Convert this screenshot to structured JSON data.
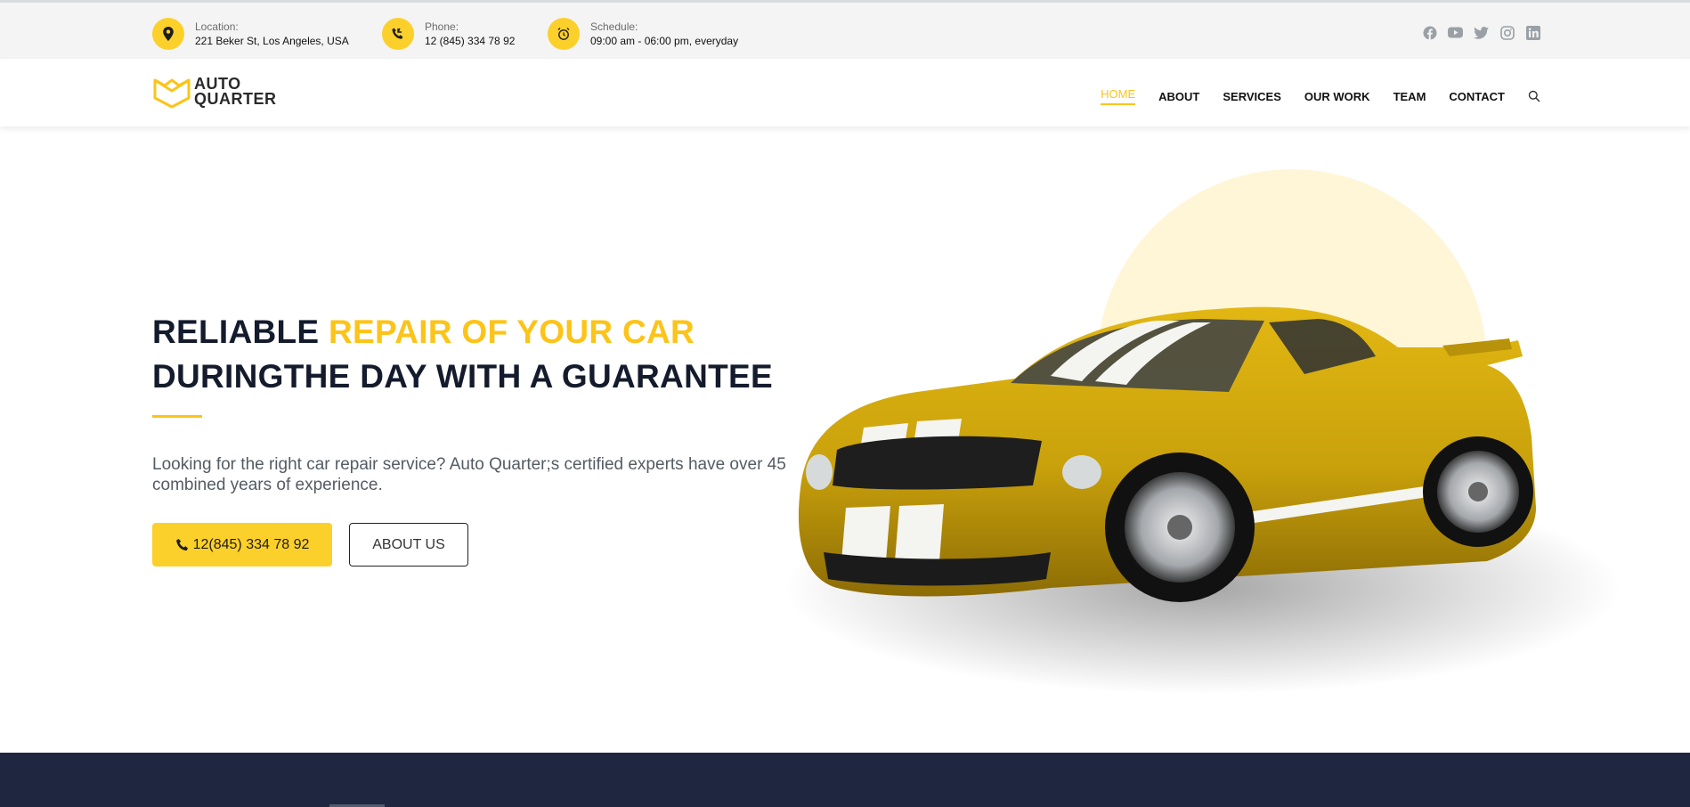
{
  "topbar": {
    "location": {
      "label": "Location:",
      "value": "221 Beker St, Los Angeles, USA"
    },
    "phone": {
      "label": "Phone:",
      "value": "12 (845) 334 78 92"
    },
    "schedule": {
      "label": "Schedule:",
      "value": "09:00 am - 06:00 pm, everyday"
    },
    "social": [
      "facebook-icon",
      "youtube-icon",
      "twitter-icon",
      "instagram-icon",
      "linkedin-icon"
    ]
  },
  "logo": {
    "line1": "AUTO",
    "line2": "QUARTER"
  },
  "nav": {
    "items": [
      "HOME",
      "ABOUT",
      "SERVICES",
      "OUR WORK",
      "TEAM",
      "CONTACT"
    ],
    "active": "HOME"
  },
  "hero": {
    "title_part1": "RELIABLE ",
    "title_accent": "REPAIR OF YOUR CAR",
    "title_line2": "DURINGTHE DAY WITH A GUARANTEE",
    "description": "Looking for the right car repair service? Auto Quarter;s certified experts have over 45 combined years of experience.",
    "phone_button": "12(845) 334 78 92",
    "about_button": "ABOUT US"
  },
  "colors": {
    "accent": "#fcc419",
    "dark": "#141b2d",
    "band": "#1f2740"
  }
}
